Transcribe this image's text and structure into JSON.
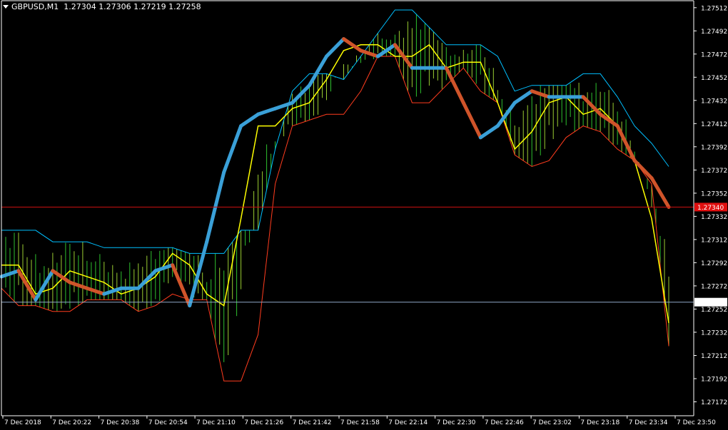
{
  "header": {
    "symbol": "GBPUSD,M1",
    "ohlc": "1.27304 1.27306 1.27219 1.27258"
  },
  "colors": {
    "background": "#000000",
    "axis": "#ffffff",
    "candle": "#2fc12f",
    "candle_down": "#9acd32",
    "upper_band": "#00bfff",
    "lower_band": "#ff3c1e",
    "fast_ma": "#ffff00",
    "smooth_up": "#3aa0d8",
    "smooth_down": "#d0542a",
    "ask_line": "#d01010",
    "bid_line": "#8fa8c8"
  },
  "chart_data": {
    "type": "line",
    "title": "GBPUSD,M1",
    "y_tick_labels": [
      "1.27512",
      "1.27492",
      "1.27472",
      "1.27452",
      "1.27432",
      "1.27412",
      "1.27392",
      "1.27372",
      "1.27352",
      "1.27332",
      "1.27312",
      "1.27292",
      "1.27272",
      "1.27252",
      "1.27232",
      "1.27212",
      "1.27192",
      "1.27172"
    ],
    "x_tick_labels": [
      "7 Dec 2018",
      "7 Dec 20:22",
      "7 Dec 20:38",
      "7 Dec 20:54",
      "7 Dec 21:10",
      "7 Dec 21:26",
      "7 Dec 21:42",
      "7 Dec 21:58",
      "7 Dec 22:14",
      "7 Dec 22:30",
      "7 Dec 22:46",
      "7 Dec 23:02",
      "7 Dec 23:18",
      "7 Dec 23:34",
      "7 Dec 23:50"
    ],
    "ylim": [
      1.2716,
      1.27518
    ],
    "price_levels": [
      {
        "name": "ask",
        "value": 1.2734,
        "label": "1.27340"
      },
      {
        "name": "bid",
        "value": 1.27258,
        "label": "1.27258"
      }
    ],
    "x_index": [
      0,
      6,
      12,
      18,
      24,
      30,
      36,
      42,
      48,
      54,
      60,
      66,
      72,
      78,
      84,
      90,
      96,
      102,
      108,
      114,
      120,
      126,
      132,
      138,
      144,
      150,
      156,
      162,
      168,
      174,
      180,
      186,
      192,
      198,
      204,
      210,
      216,
      222,
      228,
      234
    ],
    "series": [
      {
        "values": [
          1.2732,
          1.2732,
          1.2732,
          1.2731,
          1.2731,
          1.2731,
          1.27305,
          1.27305,
          1.27305,
          1.27305,
          1.27305,
          1.273,
          1.273,
          1.273,
          1.2732,
          1.2732,
          1.2739,
          1.2744,
          1.27455,
          1.27455,
          1.2745,
          1.2747,
          1.2749,
          1.2751,
          1.2751,
          1.27495,
          1.2748,
          1.2748,
          1.2748,
          1.2747,
          1.2744,
          1.27445,
          1.27445,
          1.27445,
          1.27455,
          1.27455,
          1.27435,
          1.2741,
          1.27395,
          1.27375
        ]
      },
      {
        "values": [
          1.2727,
          1.27255,
          1.27255,
          1.2725,
          1.2725,
          1.2726,
          1.2726,
          1.2726,
          1.2725,
          1.27255,
          1.27265,
          1.2726,
          1.2726,
          1.2719,
          1.2719,
          1.2723,
          1.2736,
          1.2741,
          1.27415,
          1.2742,
          1.2742,
          1.2744,
          1.2747,
          1.2747,
          1.2743,
          1.2743,
          1.27445,
          1.2746,
          1.2744,
          1.2743,
          1.27385,
          1.27375,
          1.2738,
          1.274,
          1.2741,
          1.27405,
          1.2739,
          1.2738,
          1.2736,
          1.2722
        ]
      },
      {
        "values": [
          1.2729,
          1.2729,
          1.27265,
          1.2727,
          1.27285,
          1.2728,
          1.27275,
          1.27265,
          1.2727,
          1.2728,
          1.273,
          1.2729,
          1.27265,
          1.27255,
          1.2733,
          1.2741,
          1.2741,
          1.27425,
          1.2743,
          1.2745,
          1.27475,
          1.2748,
          1.2748,
          1.2747,
          1.2747,
          1.2748,
          1.2746,
          1.27465,
          1.27465,
          1.2743,
          1.2739,
          1.27405,
          1.2743,
          1.27435,
          1.2742,
          1.27425,
          1.2741,
          1.2738,
          1.2733,
          1.2724
        ]
      },
      {
        "values": [
          1.2728,
          1.27285,
          1.2726,
          1.27285,
          1.27275,
          1.2727,
          1.27265,
          1.2727,
          1.2727,
          1.27285,
          1.2729,
          1.27255,
          1.2731,
          1.2737,
          1.2741,
          1.2742,
          1.27425,
          1.2743,
          1.27445,
          1.2747,
          1.27485,
          1.27475,
          1.2747,
          1.2748,
          1.2746,
          1.2746,
          1.2746,
          1.2743,
          1.274,
          1.2741,
          1.2743,
          1.2744,
          1.27435,
          1.27435,
          1.27435,
          1.2742,
          1.2741,
          1.2738,
          1.27365,
          1.2734
        ]
      }
    ]
  }
}
